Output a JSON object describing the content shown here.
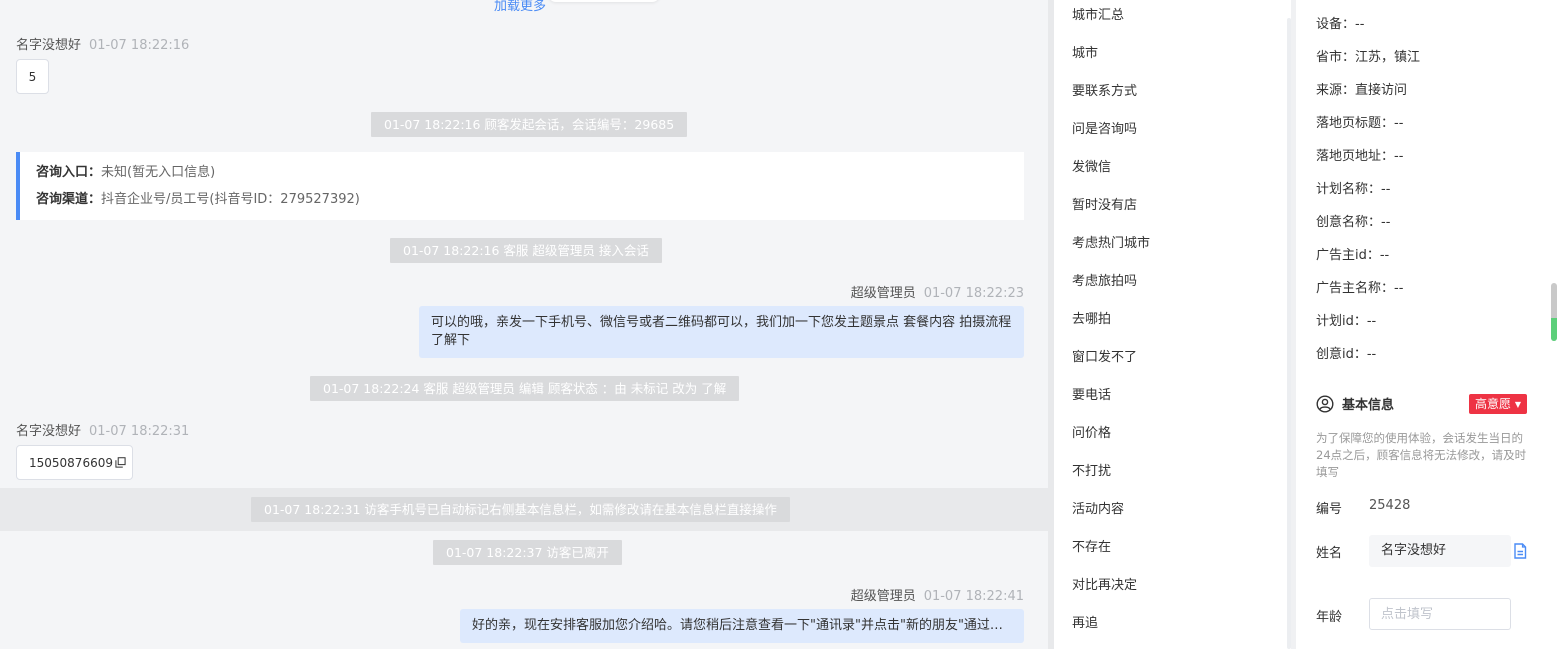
{
  "chat": {
    "load_more": "加载更多",
    "messages": [
      {
        "sender": "名字没想好",
        "time": "01-07 18:22:16",
        "text": "5"
      },
      {
        "system": "01-07 18:22:16 顾客发起会话，会话编号：29685"
      },
      {
        "system": "01-07 18:22:16 客服 超级管理员 接入会话"
      },
      {
        "sender": "超级管理员",
        "time": "01-07 18:22:23",
        "text": "可以的哦，亲发一下手机号、微信号或者二维码都可以，我们加一下您发主题景点 套餐内容 拍摄流程了解下"
      },
      {
        "system": "01-07 18:22:24 客服 超级管理员 编辑 顾客状态 ：由 未标记 改为 了解"
      },
      {
        "sender": "名字没想好",
        "time": "01-07 18:22:31",
        "text": "15050876609"
      },
      {
        "system": "01-07 18:22:31 访客手机号已自动标记右侧基本信息栏，如需修改请在基本信息栏直接操作"
      },
      {
        "system": "01-07 18:22:37 访客已离开"
      },
      {
        "sender": "超级管理员",
        "time": "01-07 18:22:41",
        "text": "好的亲，现在安排客服加您介绍哈。请您稍后注意查看一下\"通讯录\"并点击\"新的朋友\"通过下哦"
      }
    ],
    "info_card": {
      "entry_label": "咨询入口：",
      "entry_value": "未知(暂无入口信息)",
      "channel_label": "咨询渠道：",
      "channel_value": "抖音企业号/员工号(抖音号ID：279527392)"
    }
  },
  "tags": [
    "城市汇总",
    "城市",
    "要联系方式",
    "问是咨询吗",
    "发微信",
    "暂时没有店",
    "考虑热门城市",
    "考虑旅拍吗",
    "去哪拍",
    "窗口发不了",
    "要电话",
    "问价格",
    "不打扰",
    "活动内容",
    "不存在",
    "对比再决定",
    "再追"
  ],
  "visitor_info": [
    "设备：--",
    "省市：江苏，镇江",
    "来源：直接访问",
    "落地页标题：--",
    "落地页地址：--",
    "计划名称：--",
    "创意名称：--",
    "广告主id：--",
    "广告主名称：--",
    "计划id：--",
    "创意id：--"
  ],
  "basic_info": {
    "title": "基本信息",
    "intent_badge": "高意愿",
    "note": "为了保障您的使用体验，会话发生当日的24点之后，顾客信息将无法修改，请及时填写",
    "id_label": "编号",
    "id_value": "25428",
    "name_label": "姓名",
    "name_value": "名字没想好",
    "age_label": "年龄",
    "age_placeholder": "点击填写"
  },
  "colors": {
    "accent": "#4a8bf5",
    "agent_bubble": "#dde9fd",
    "system_msg": "#d9dadc",
    "badge": "#ee3344"
  }
}
